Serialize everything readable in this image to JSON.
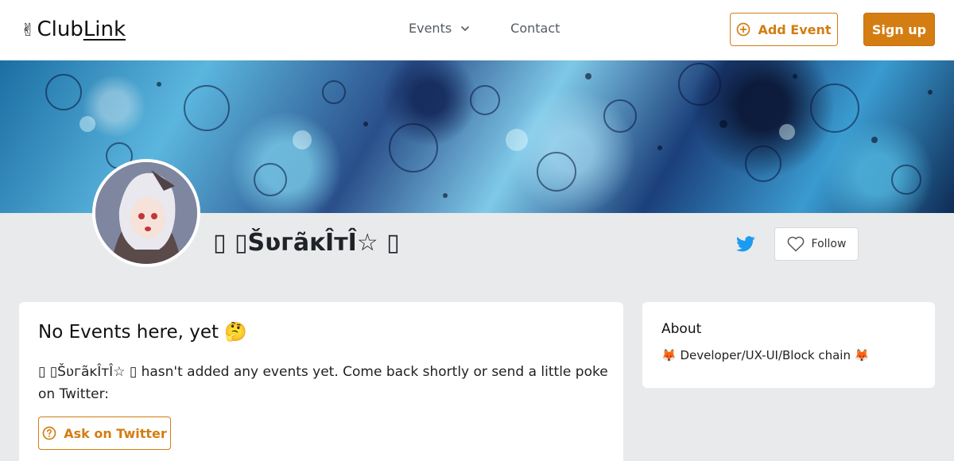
{
  "header": {
    "logo_emoji": "✌",
    "logo_text_a": "Club",
    "logo_text_b": "Link",
    "nav_events": "Events",
    "nav_contact": "Contact",
    "add_event_label": "Add Event",
    "signup_label": "Sign up"
  },
  "profile": {
    "name": "▯ ▯ŠʋгãĸÎтÎ☆ ▯",
    "follow_label": "Follow"
  },
  "events_card": {
    "title": "No Events here, yet 🤔",
    "message": "▯ ▯ŠʋгãĸÎтÎ☆ ▯ hasn't added any events yet. Come back shortly or send a little poke on Twitter:",
    "ask_label": "Ask on Twitter"
  },
  "about_card": {
    "title": "About",
    "bio": "🦊 Developer/UX-UI/Block chain 🦊"
  },
  "colors": {
    "accent": "#d47d12",
    "twitter": "#1d9bf0",
    "page_bg": "#e9eaeb"
  },
  "icons": {
    "add_event": "plus-circle-icon",
    "events_dropdown": "chevron-down-icon",
    "twitter": "twitter-icon",
    "follow": "heart-icon",
    "ask": "question-circle-icon"
  }
}
